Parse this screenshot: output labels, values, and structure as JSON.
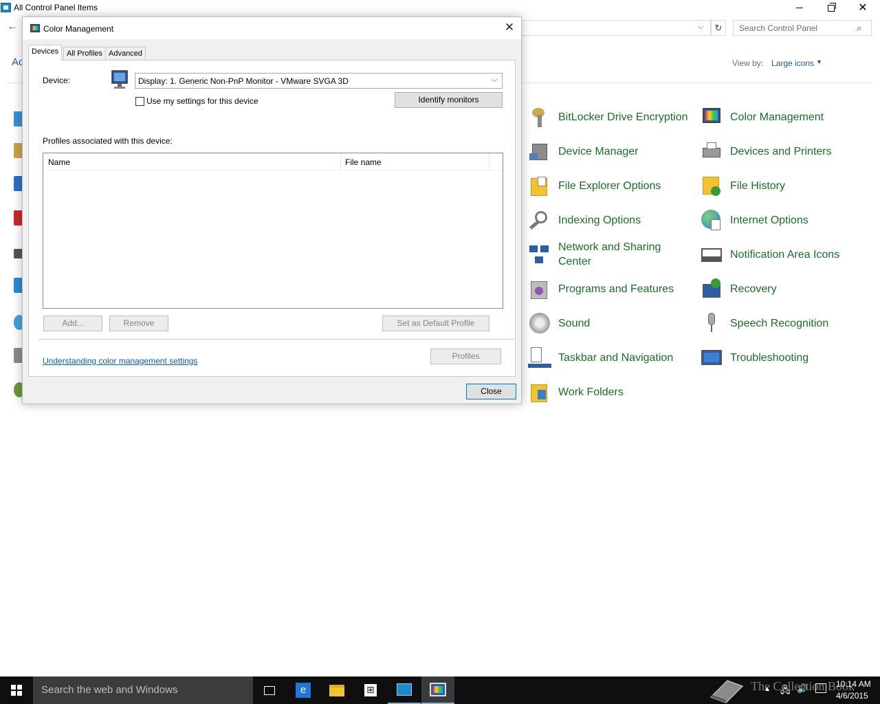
{
  "window": {
    "title": "All Control Panel Items",
    "heading_fragment": "Ac"
  },
  "address": {
    "search_placeholder": "Search Control Panel"
  },
  "view_by": {
    "label": "View by:",
    "value": "Large icons"
  },
  "control_panel_items": [
    {
      "label": "BitLocker Drive Encryption",
      "icon": "bitlocker-icon"
    },
    {
      "label": "Color Management",
      "icon": "color-management-icon"
    },
    {
      "label": "Device Manager",
      "icon": "device-manager-icon"
    },
    {
      "label": "Devices and Printers",
      "icon": "printer-icon"
    },
    {
      "label": "File Explorer Options",
      "icon": "folder-options-icon"
    },
    {
      "label": "File History",
      "icon": "file-history-icon"
    },
    {
      "label": "Indexing Options",
      "icon": "indexing-icon"
    },
    {
      "label": "Internet Options",
      "icon": "globe-icon"
    },
    {
      "label": "Network and Sharing Center",
      "icon": "network-icon"
    },
    {
      "label": "Notification Area Icons",
      "icon": "notification-area-icon"
    },
    {
      "label": "Programs and Features",
      "icon": "programs-icon"
    },
    {
      "label": "Recovery",
      "icon": "recovery-icon"
    },
    {
      "label": "Sound",
      "icon": "speaker-icon"
    },
    {
      "label": "Speech Recognition",
      "icon": "microphone-icon"
    },
    {
      "label": "Taskbar and Navigation",
      "icon": "taskbar-icon"
    },
    {
      "label": "Troubleshooting",
      "icon": "troubleshooting-icon"
    },
    {
      "label": "Work Folders",
      "icon": "work-folders-icon"
    }
  ],
  "dialog": {
    "title": "Color Management",
    "tabs": [
      "Devices",
      "All Profiles",
      "Advanced"
    ],
    "device_label": "Device:",
    "device_value": "Display: 1. Generic Non-PnP Monitor - VMware SVGA 3D",
    "use_my_settings": "Use my settings for this device",
    "use_my_settings_checked": false,
    "identify_button": "Identify monitors",
    "profiles_label": "Profiles associated with this device:",
    "columns": [
      "Name",
      "File name"
    ],
    "add_button": "Add...",
    "remove_button": "Remove",
    "default_button": "Set as Default Profile",
    "help_link": "Understanding color management settings",
    "profiles_button": "Profiles",
    "close_button": "Close"
  },
  "taskbar": {
    "search_placeholder": "Search the web and Windows",
    "watermark": "The Collection Book",
    "time": "10:14 AM",
    "date": "4/6/2015"
  }
}
